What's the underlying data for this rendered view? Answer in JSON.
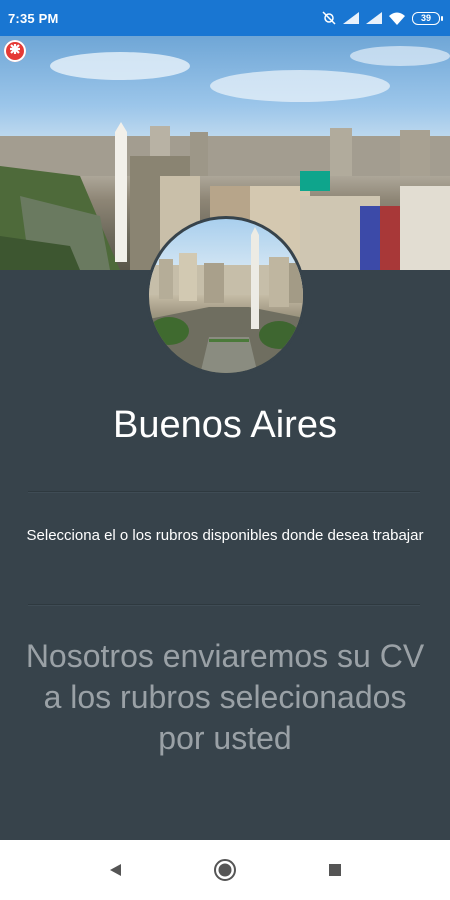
{
  "status_bar": {
    "time": "7:35 PM",
    "battery": "39",
    "icons": [
      "mute-icon",
      "signal-icon",
      "signal-icon",
      "wifi-icon",
      "battery-icon"
    ]
  },
  "header": {
    "close_icon": "close-icon"
  },
  "city": {
    "name": "Buenos Aires"
  },
  "instruction": "Selecciona el o los rubros disponibles donde desea trabajar",
  "message": "Nosotros enviaremos su CV a los rubros selecionados por usted",
  "nav_bar": {
    "back_icon": "back-triangle-icon",
    "home_icon": "home-circle-icon",
    "recents_icon": "recents-square-icon"
  },
  "colors": {
    "status_bar": "#1976d2",
    "panel": "#37434b",
    "title_text": "#ffffff",
    "message_text": "#9aa1a6",
    "close_button": "#e53935"
  }
}
